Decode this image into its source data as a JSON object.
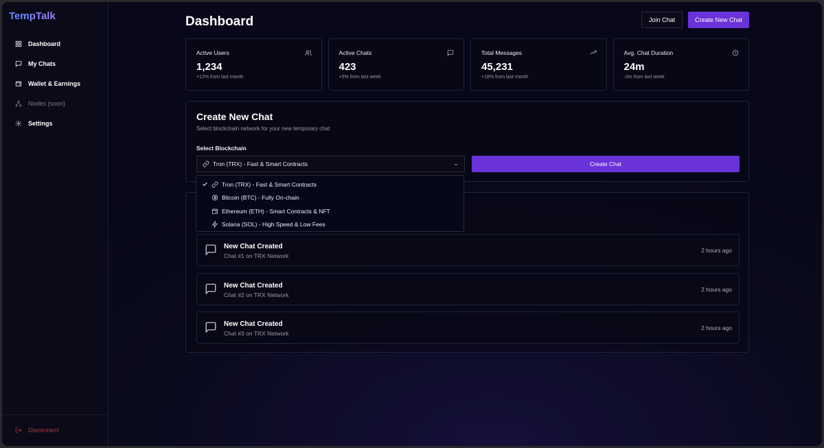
{
  "app": {
    "brand": "TempTalk"
  },
  "sidebar": {
    "items": [
      {
        "label": "Dashboard",
        "icon": "grid-icon"
      },
      {
        "label": "My Chats",
        "icon": "message-icon"
      },
      {
        "label": "Wallet & Earnings",
        "icon": "wallet-icon"
      },
      {
        "label": "Nodes (soon)",
        "icon": "network-icon",
        "disabled": true
      },
      {
        "label": "Settings",
        "icon": "gear-icon"
      }
    ],
    "disconnect_label": "Disconnect"
  },
  "header": {
    "title": "Dashboard",
    "join_label": "Join Chat",
    "create_label": "Create New Chat"
  },
  "stats": [
    {
      "label": "Active Users",
      "value": "1,234",
      "sub": "+12% from last month",
      "icon": "users-icon"
    },
    {
      "label": "Active Chats",
      "value": "423",
      "sub": "+5% from last week",
      "icon": "message-icon"
    },
    {
      "label": "Total Messages",
      "value": "45,231",
      "sub": "+18% from last month",
      "icon": "trending-up-icon"
    },
    {
      "label": "Avg. Chat Duration",
      "value": "24m",
      "sub": "-2m from last week",
      "icon": "clock-icon"
    }
  ],
  "create": {
    "title": "Create New Chat",
    "subtitle": "Select blockchain network for your new temporary chat",
    "select_label": "Select Blockchain",
    "selected": "Tron (TRX) - Fast & Smart Contracts",
    "button_label": "Create Chat",
    "options": [
      {
        "label": "Tron (TRX) - Fast & Smart Contracts",
        "icon": "link-icon",
        "selected": true
      },
      {
        "label": "Bitcoin (BTC) - Fully On-chain",
        "icon": "coin-icon"
      },
      {
        "label": "Ethereum (ETH) - Smart Contracts & NFT",
        "icon": "wallet-icon"
      },
      {
        "label": "Solana (SOL) - High Speed & Low Fees",
        "icon": "bolt-icon"
      }
    ]
  },
  "activity": [
    {
      "title": "New Chat Created",
      "sub": "Chat #1 on TRX Network",
      "time": "2 hours ago"
    },
    {
      "title": "New Chat Created",
      "sub": "Chat #2 on TRX Network",
      "time": "2 hours ago"
    },
    {
      "title": "New Chat Created",
      "sub": "Chat #3 on TRX Network",
      "time": "2 hours ago"
    }
  ],
  "colors": {
    "accent": "#6a32d9",
    "danger": "#a83a3a",
    "background": "#0a0a1d"
  }
}
